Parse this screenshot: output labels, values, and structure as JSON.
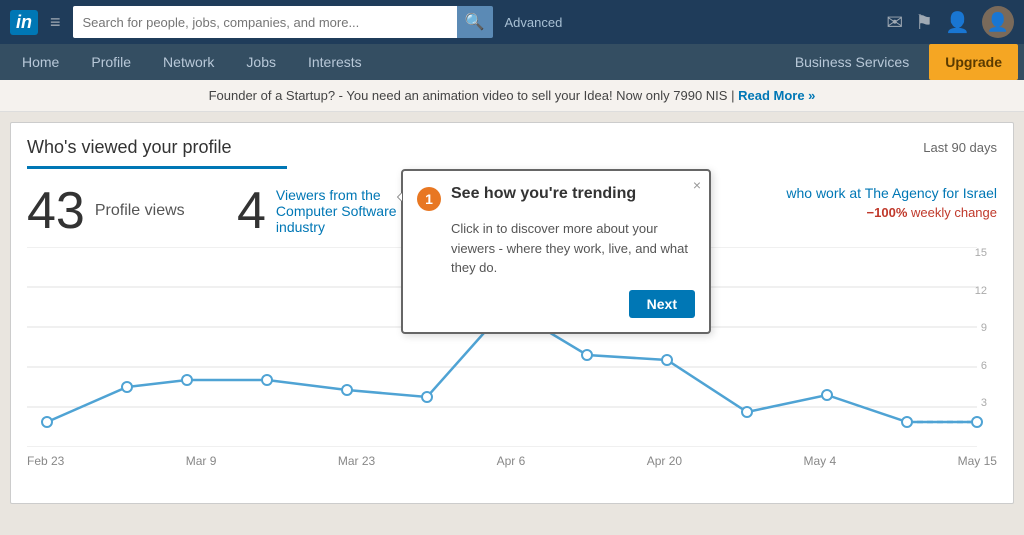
{
  "topbar": {
    "logo": "in",
    "search_placeholder": "Search for people, jobs, companies, and more...",
    "search_btn_icon": "🔍",
    "advanced_label": "Advanced",
    "icons": [
      "✉",
      "🚩",
      "👤"
    ],
    "hamburger": "≡"
  },
  "navbar": {
    "items_left": [
      "Home",
      "Profile",
      "Network",
      "Jobs",
      "Interests"
    ],
    "items_right": [
      "Business Services",
      "Upgrade"
    ]
  },
  "banner": {
    "text": "Founder of a Startup? - You need an animation video to sell your Idea! Now only 7990 NIS |",
    "link_text": "Read More »"
  },
  "main": {
    "section_title": "Who's viewed your profile",
    "last_days": "Last 90 days",
    "profile_views_count": "43",
    "profile_views_label": "Profile views",
    "viewers_count": "4",
    "viewers_label": "Viewers from the Computer Software industry",
    "company_label": "who work at The Agency for Israel",
    "weekly_change": "−100%",
    "weekly_change_suffix": " weekly change"
  },
  "tooltip": {
    "badge": "1",
    "title": "See how you're trending",
    "body": "Click in to discover more about your viewers - where they work, live, and what they do.",
    "next_btn": "Next",
    "close": "×"
  },
  "chart": {
    "x_labels": [
      "Feb 23",
      "Mar 9",
      "Mar 23",
      "Apr 6",
      "Apr 20",
      "May 4",
      "May 15"
    ],
    "y_labels": [
      "15",
      "12",
      "9",
      "6",
      "3",
      ""
    ],
    "accent_color": "#4fa3d4",
    "dashed_color": "#4fa3d4"
  }
}
